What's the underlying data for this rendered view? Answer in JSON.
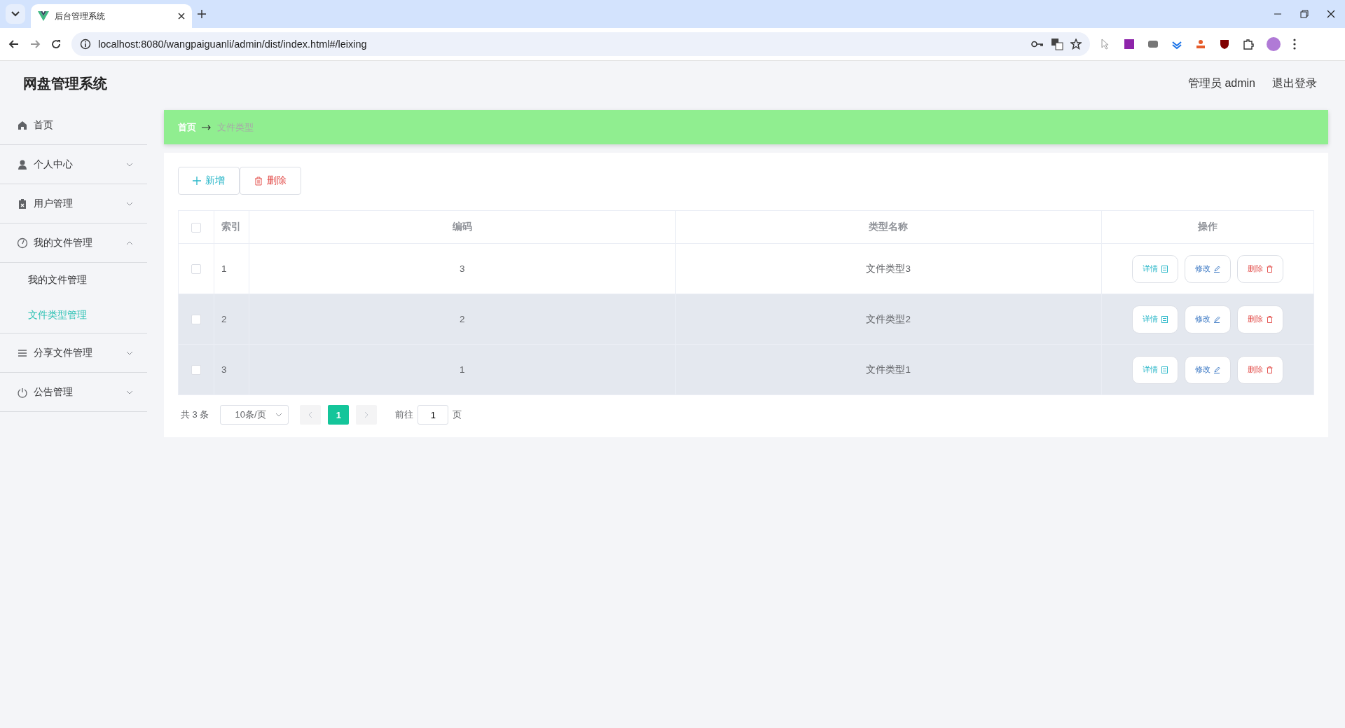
{
  "browser": {
    "tab_title": "后台管理系统",
    "url": "localhost:8080/wangpaiguanli/admin/dist/index.html#/leixing"
  },
  "header": {
    "title": "网盘管理系统",
    "user": "管理员 admin",
    "logout": "退出登录"
  },
  "sidebar": {
    "items": [
      {
        "label": "首页",
        "selected": false
      },
      {
        "label": "个人中心",
        "selected": false,
        "expanded": false
      },
      {
        "label": "用户管理",
        "selected": false,
        "expanded": false
      },
      {
        "label": "我的文件管理",
        "selected": false,
        "expanded": true,
        "children": [
          {
            "label": "我的文件管理",
            "selected": false
          },
          {
            "label": "文件类型管理",
            "selected": true
          }
        ]
      },
      {
        "label": "分享文件管理",
        "selected": false,
        "expanded": false
      },
      {
        "label": "公告管理",
        "selected": false,
        "expanded": false
      }
    ]
  },
  "breadcrumb": [
    "首页",
    "文件类型"
  ],
  "toolbar": {
    "add": "新增",
    "delete": "删除"
  },
  "table": {
    "all_checked": false,
    "columns": [
      "索引",
      "编码",
      "类型名称",
      "操作"
    ],
    "rows": [
      {
        "index": "1",
        "code": "3",
        "name": "文件类型3",
        "checked": false,
        "shaded": false,
        "actions": [
          "详情",
          "修改",
          "删除"
        ]
      },
      {
        "index": "2",
        "code": "2",
        "name": "文件类型2",
        "checked": false,
        "shaded": true,
        "actions": [
          "详情",
          "修改",
          "删除"
        ]
      },
      {
        "index": "3",
        "code": "1",
        "name": "文件类型1",
        "checked": false,
        "shaded": true,
        "actions": [
          "详情",
          "修改",
          "删除"
        ]
      }
    ]
  },
  "pagination": {
    "total": "共 3 条",
    "page_size": "10条/页",
    "pages": [
      {
        "label": "1",
        "selected": true
      }
    ],
    "goto_label": "前往",
    "goto_value": "1",
    "goto_suffix": "页"
  }
}
